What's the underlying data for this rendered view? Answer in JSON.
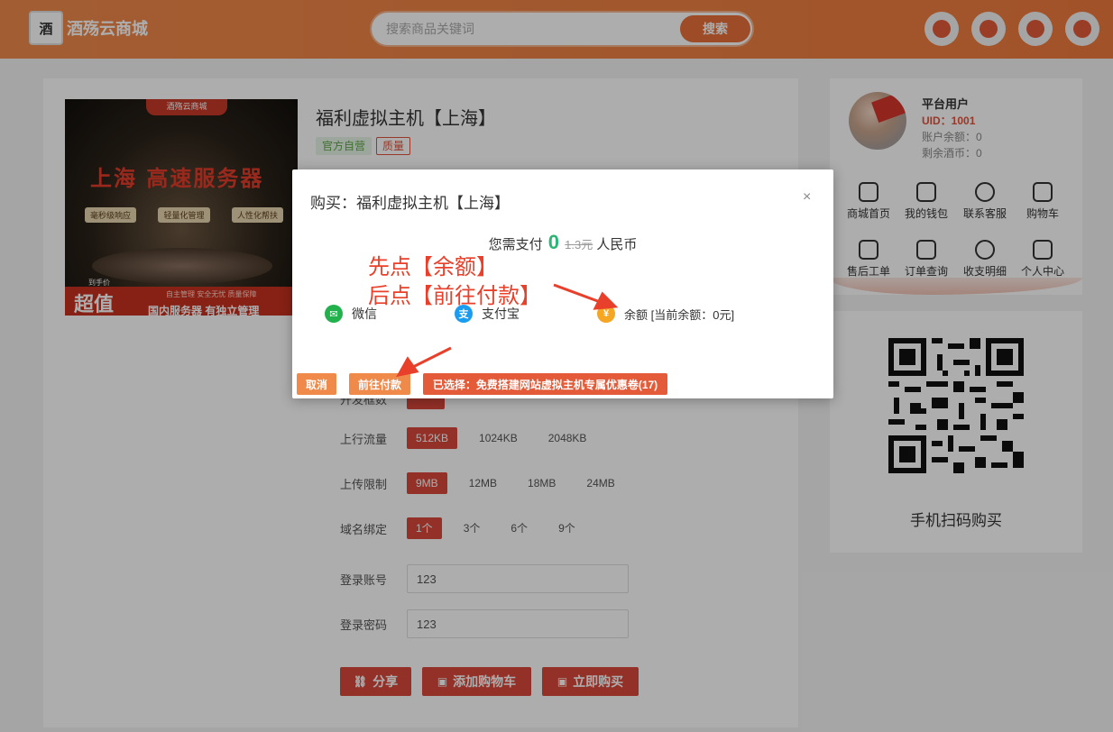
{
  "header": {
    "logo_mark": "酒",
    "site_name": "酒殇云商城",
    "search_placeholder": "搜索商品关键词",
    "search_button": "搜索",
    "icons": [
      "smile-icon",
      "gift-icon",
      "message-icon",
      "user-icon"
    ]
  },
  "product": {
    "image": {
      "top_badge": "酒殇云商城",
      "headline": "上海 高速服务器",
      "tags": [
        "毫秒级响应",
        "轻量化管理",
        "人性化帮扶"
      ],
      "chao_small": "到手价",
      "chao": "超值",
      "bottom_small": "自主管理 安全无忧 质量保障",
      "bottom_text": "国内服务器 有独立管理"
    },
    "title": "福利虚拟主机【上海】",
    "badges": [
      "官方自营",
      "质量"
    ],
    "options": [
      {
        "label": "上行流量",
        "values": [
          "512KB",
          "1024KB",
          "2048KB"
        ],
        "selected": 0
      },
      {
        "label": "上传限制",
        "values": [
          "9MB",
          "12MB",
          "18MB",
          "24MB"
        ],
        "selected": 0
      },
      {
        "label": "域名绑定",
        "values": [
          "1个",
          "3个",
          "6个",
          "9个"
        ],
        "selected": 0
      }
    ],
    "hidden_row_label": "开发框数",
    "login_account_label": "登录账号",
    "login_account_value": "123",
    "login_password_label": "登录密码",
    "login_password_value": "123",
    "actions": [
      "分享",
      "添加购物车",
      "立即购买"
    ]
  },
  "user": {
    "name": "平台用户",
    "uid": "UID：1001",
    "balance": "账户余额：0",
    "coins": "剩余酒币：0",
    "menu": [
      "商城首页",
      "我的钱包",
      "联系客服",
      "购物车",
      "售后工单",
      "订单查询",
      "收支明细",
      "个人中心"
    ]
  },
  "qr": {
    "label": "手机扫码购买"
  },
  "modal": {
    "title": "购买：福利虚拟主机【上海】",
    "close": "×",
    "pay_prefix": "您需支付",
    "pay_amount": "0",
    "pay_original": "1.3元",
    "pay_suffix": "人民币",
    "note1": "先点【余额】",
    "note2": "后点【前往付款】",
    "methods": [
      "微信",
      "支付宝",
      "余额 [当前余额：0元]"
    ],
    "cancel": "取消",
    "go_pay": "前往付款",
    "coupon": "已选择：免费搭建网站虚拟主机专属优惠卷(17)",
    "colors": {
      "accent": "#ef7a3c",
      "red": "#e8402a",
      "green": "#2bb673"
    }
  }
}
